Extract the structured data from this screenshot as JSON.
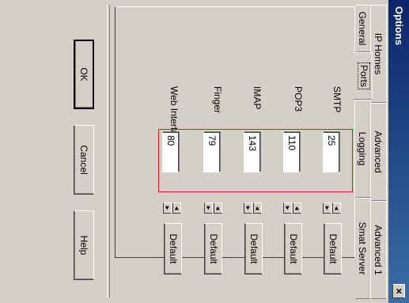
{
  "window": {
    "title": "Options",
    "close_glyph": "×"
  },
  "tabs": {
    "row1": [
      "IP Homes",
      "Advanced",
      "Advanced 1"
    ],
    "row2": [
      "General",
      "Ports",
      "Logging",
      "Smat Server"
    ],
    "selected": "Ports"
  },
  "ports": [
    {
      "label": "SMTP",
      "value": "25",
      "button": "Default"
    },
    {
      "label": "POP3",
      "value": "110",
      "button": "Default"
    },
    {
      "label": "IMAP",
      "value": "143",
      "button": "Default"
    },
    {
      "label": "Finger",
      "value": "79",
      "button": "Default"
    },
    {
      "label": "Web Interface",
      "value": "80",
      "button": "Default"
    }
  ],
  "spin": {
    "up": "◄",
    "down": "►"
  },
  "buttons": {
    "ok": "OK",
    "cancel": "Cancel",
    "help": "Help"
  },
  "highlight_color": "#e21b1b"
}
